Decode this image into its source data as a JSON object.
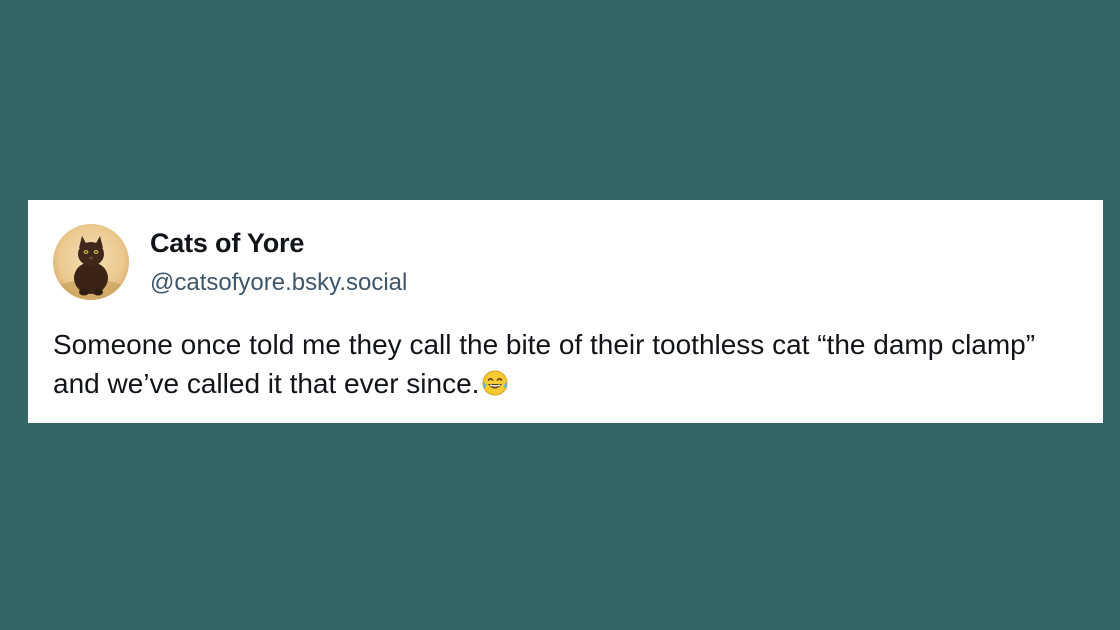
{
  "post": {
    "author_name": "Cats of Yore",
    "author_handle": "@catsofyore.bsky.social",
    "text": "Someone once told me they call the bite of their toothless cat “the damp clamp” and we’ve called it that ever since.",
    "emoji": "face-with-tears-of-joy-icon"
  },
  "colors": {
    "background": "#336666",
    "card": "#ffffff",
    "text": "#111418",
    "handle": "#3f5569"
  }
}
